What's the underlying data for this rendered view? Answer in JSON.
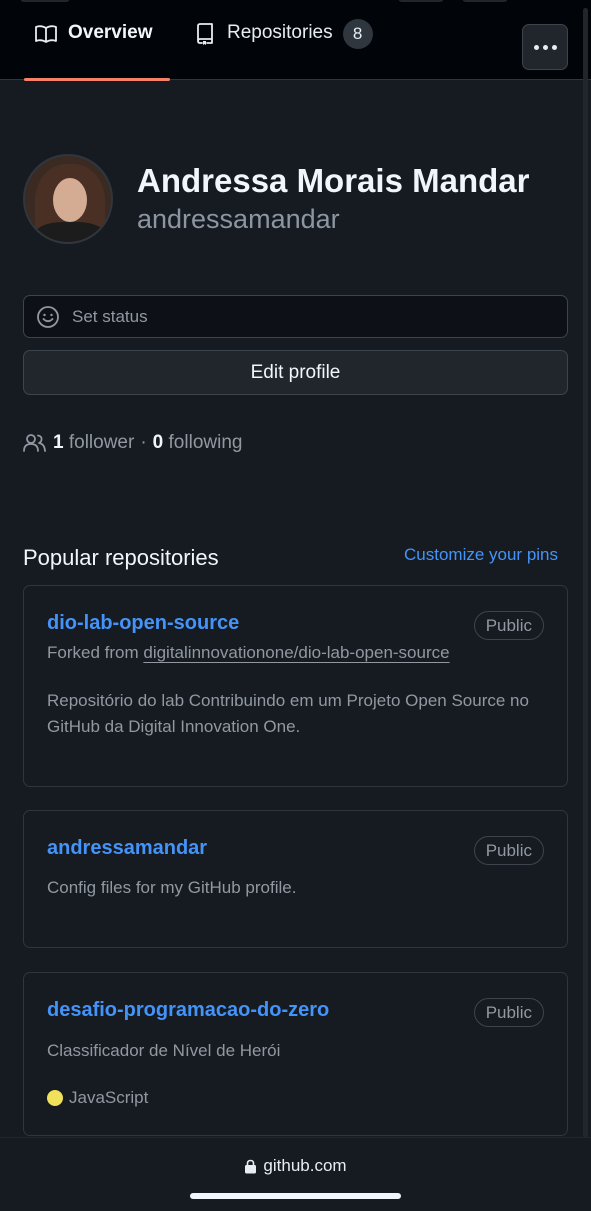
{
  "nav": {
    "tabs": [
      {
        "label": "Overview",
        "icon": "book-icon",
        "selected": true
      },
      {
        "label": "Repositories",
        "icon": "repo-icon",
        "count": "8"
      }
    ],
    "more_icon": "kebab-horizontal-icon"
  },
  "profile": {
    "name": "Andressa Morais Mandar",
    "login": "andressamandar",
    "status_label": "Set status",
    "edit_label": "Edit profile",
    "followers_count": "1",
    "followers_label": "follower",
    "separator": "·",
    "following_count": "0",
    "following_label": "following"
  },
  "pinned": {
    "title": "Popular repositories",
    "customize_label": "Customize your pins",
    "repos": [
      {
        "name": "dio-lab-open-source",
        "visibility": "Public",
        "forked_prefix": "Forked from",
        "forked_from": "digitalinnovationone/dio-lab-open-source",
        "description": "Repositório do lab Contribuindo em um Projeto Open Source no GitHub da Digital Innovation One."
      },
      {
        "name": "andressamandar",
        "visibility": "Public",
        "description": "Config files for my GitHub profile."
      },
      {
        "name": "desafio-programacao-do-zero",
        "visibility": "Public",
        "description": "Classificador de Nível de Herói",
        "language": "JavaScript",
        "language_color": "#f1e05a"
      }
    ]
  },
  "browser": {
    "url": "github.com",
    "lock_icon": "lock-icon"
  },
  "colors": {
    "accent_link": "#4493f8",
    "tab_underline": "#f78166",
    "background": "#161b22"
  }
}
